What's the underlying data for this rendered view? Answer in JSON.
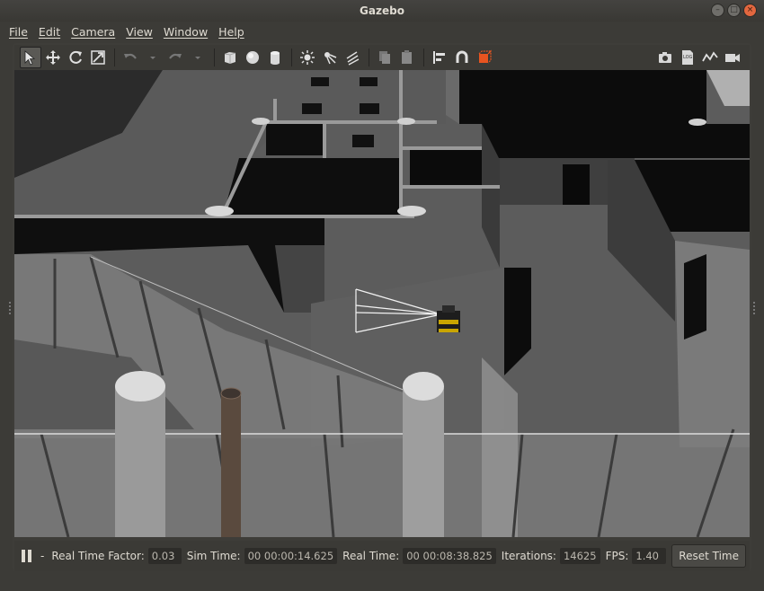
{
  "window": {
    "title": "Gazebo"
  },
  "menu": [
    "File",
    "Edit",
    "Camera",
    "View",
    "Window",
    "Help"
  ],
  "toolbar": {
    "left_tools": [
      "select-mode",
      "translate-mode",
      "rotate-mode",
      "scale-mode"
    ],
    "history_tools": [
      "undo",
      "undo-dropdown",
      "redo",
      "redo-dropdown"
    ],
    "shape_tools": [
      "box",
      "sphere",
      "cylinder"
    ],
    "light_tools": [
      "point-light",
      "spot-light",
      "directional-light"
    ],
    "edit_tools": [
      "copy",
      "paste"
    ],
    "align_tools": [
      "align",
      "snap",
      "change-view"
    ],
    "right_tools": [
      "screenshot",
      "log",
      "plot",
      "record-video"
    ]
  },
  "status": {
    "pause_icon": "pause-icon",
    "dash": "-",
    "real_time_factor_label": "Real Time Factor:",
    "real_time_factor": "0.03",
    "sim_time_label": "Sim Time:",
    "sim_time": "00 00:00:14.625",
    "real_time_label": "Real Time:",
    "real_time": "00 00:08:38.825",
    "iterations_label": "Iterations:",
    "iterations": "14625",
    "fps_label": "FPS:",
    "fps": "1.40",
    "reset_label": "Reset Time"
  },
  "colors": {
    "accent": "#e95420",
    "sky": "#9a9a9a",
    "floor": "#5e5e5e"
  }
}
